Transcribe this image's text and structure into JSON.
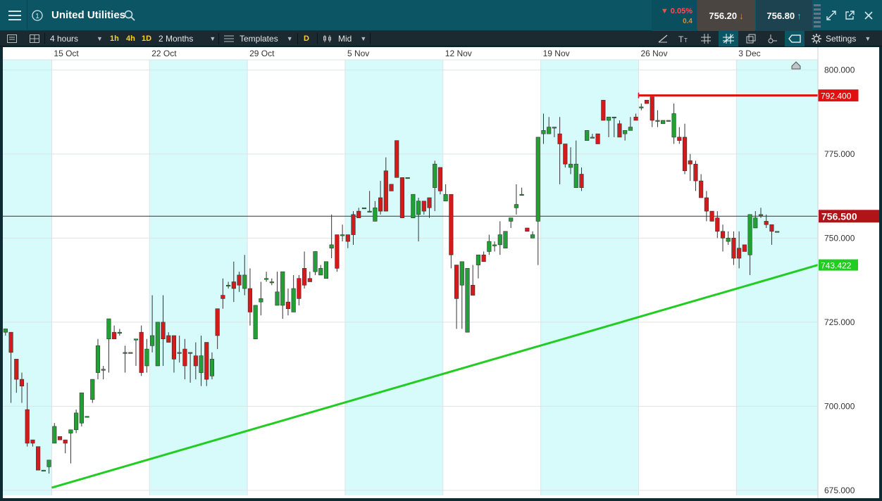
{
  "header": {
    "instrument": "United Utilities",
    "change_pct": "0.05%",
    "change_abs": "0.4",
    "sell_price": "756.20",
    "buy_price": "756.80",
    "colors": {
      "bar": "#0c5564",
      "sell": "#4a4540",
      "buy": "#1e4350",
      "down": "#ff4d4d"
    }
  },
  "toolbar": {
    "interval": "4 hours",
    "quick_1h": "1h",
    "quick_4h": "4h",
    "quick_1d": "1D",
    "range": "2 Months",
    "templates": "Templates",
    "d_badge": "D",
    "price_type": "Mid",
    "settings": "Settings"
  },
  "chart_data": {
    "type": "candlestick",
    "title": "",
    "xlabel": "",
    "ylabel": "",
    "ylim": [
      673.5,
      803
    ],
    "y_ticks": [
      {
        "value": 800,
        "label": "800.000"
      },
      {
        "value": 775,
        "label": "775.000"
      },
      {
        "value": 750,
        "label": "750.000"
      },
      {
        "value": 725,
        "label": "725.000"
      },
      {
        "value": 700,
        "label": "700.000"
      },
      {
        "value": 675,
        "label": "675.000"
      }
    ],
    "x_labels": [
      "15 Oct",
      "22 Oct",
      "29 Oct",
      "5 Nov",
      "12 Nov",
      "19 Nov",
      "26 Nov",
      "3 Dec"
    ],
    "x_label_slot": [
      9,
      27,
      45,
      63,
      81,
      99,
      117,
      135
    ],
    "shaded_weeks": [
      [
        0,
        9
      ],
      [
        27,
        45
      ],
      [
        63,
        81
      ],
      [
        99,
        117
      ],
      [
        135,
        150
      ]
    ],
    "total_slots": 150,
    "candles": [
      [
        722,
        723,
        721,
        722.5
      ],
      [
        722,
        716,
        701,
        709
      ],
      [
        714,
        708,
        704,
        701
      ],
      [
        708,
        706,
        701,
        710
      ],
      [
        699,
        689,
        688,
        707
      ],
      [
        690,
        689,
        688,
        689
      ],
      [
        688,
        681,
        681,
        679
      ],
      [
        681,
        681,
        681,
        681
      ],
      [
        682,
        684,
        680,
        682
      ],
      [
        689,
        694,
        689,
        695
      ],
      [
        691,
        690,
        690,
        688
      ],
      [
        690,
        689,
        686,
        689
      ],
      [
        692,
        693,
        683,
        692
      ],
      [
        693,
        698,
        692,
        699
      ],
      [
        695,
        704,
        694,
        700
      ],
      [
        697,
        697,
        697,
        697
      ],
      [
        702,
        708,
        701,
        707
      ],
      [
        710,
        718,
        708,
        720
      ],
      [
        711,
        711,
        708,
        712
      ],
      [
        720,
        726,
        710,
        722
      ],
      [
        722,
        720,
        720,
        724
      ],
      [
        722,
        722,
        721,
        723
      ],
      [
        716,
        716,
        710,
        718
      ],
      [
        716,
        716,
        716,
        716
      ],
      [
        720,
        720,
        712,
        720
      ],
      [
        722,
        710,
        709,
        724
      ],
      [
        712,
        717,
        710,
        720
      ],
      [
        718,
        721,
        716,
        733
      ],
      [
        712,
        725,
        712,
        725
      ],
      [
        725,
        720,
        712,
        733
      ],
      [
        721,
        719,
        720,
        722
      ],
      [
        721,
        714,
        710,
        718
      ],
      [
        716,
        716,
        713,
        721
      ],
      [
        717,
        712,
        708,
        720
      ],
      [
        716,
        716,
        707,
        716
      ],
      [
        715,
        712,
        708,
        719
      ],
      [
        710,
        715,
        706,
        721
      ],
      [
        719,
        708,
        706,
        719
      ],
      [
        709,
        714,
        708,
        716
      ],
      [
        729,
        721,
        717,
        727
      ],
      [
        733,
        732,
        729,
        738
      ],
      [
        736,
        736,
        735,
        737
      ],
      [
        737,
        735,
        731,
        743
      ],
      [
        739,
        736,
        734,
        740
      ],
      [
        735,
        739,
        733,
        745
      ],
      [
        735,
        728,
        724,
        741
      ],
      [
        720,
        730,
        727,
        729
      ],
      [
        731,
        732,
        727,
        737
      ],
      [
        738,
        738,
        737,
        740
      ],
      [
        737,
        737,
        736,
        738
      ],
      [
        730,
        734,
        734,
        740
      ],
      [
        730,
        740,
        726,
        738
      ],
      [
        731,
        729,
        727,
        735
      ],
      [
        728,
        735,
        728,
        739
      ],
      [
        738,
        732,
        730,
        739
      ],
      [
        741,
        736,
        735,
        746
      ],
      [
        738,
        737,
        737,
        740
      ],
      [
        740,
        746,
        739,
        746
      ],
      [
        739,
        741,
        739,
        742
      ],
      [
        738,
        743,
        738,
        743
      ],
      [
        747,
        748,
        744,
        757
      ],
      [
        751,
        741,
        740,
        751
      ],
      [
        751,
        751,
        749,
        754
      ],
      [
        751,
        749,
        747,
        751
      ],
      [
        757,
        751,
        748,
        758
      ],
      [
        758,
        756,
        756,
        759
      ],
      [
        759,
        759,
        759,
        759
      ],
      [
        758,
        758,
        758,
        764
      ],
      [
        755,
        759,
        755,
        761
      ],
      [
        762,
        758,
        757,
        767
      ],
      [
        770,
        758,
        758,
        774
      ],
      [
        766,
        764,
        764,
        766
      ],
      [
        779,
        768,
        768,
        768
      ],
      [
        768,
        756,
        756,
        766
      ],
      [
        768,
        768,
        768,
        768
      ],
      [
        756,
        763,
        762,
        763
      ],
      [
        757,
        761,
        749,
        762
      ],
      [
        761,
        758,
        757,
        759
      ],
      [
        762,
        759,
        756,
        762
      ],
      [
        765,
        772,
        758,
        773
      ],
      [
        771,
        764,
        763,
        771
      ],
      [
        761,
        763,
        763,
        766
      ],
      [
        763,
        745,
        741,
        763
      ],
      [
        742,
        732,
        723,
        739
      ],
      [
        736,
        743,
        723,
        738
      ],
      [
        722,
        741,
        723,
        741
      ],
      [
        736,
        733,
        733,
        742
      ],
      [
        742,
        745,
        738,
        742
      ],
      [
        745,
        743,
        743,
        746
      ],
      [
        746,
        749,
        745,
        751
      ],
      [
        748,
        748,
        746,
        749
      ],
      [
        748,
        751,
        745,
        755
      ],
      [
        747,
        752,
        747,
        752
      ],
      [
        755,
        756,
        753,
        755
      ],
      [
        759,
        760,
        757,
        766
      ],
      [
        763,
        763,
        764,
        765
      ],
      [
        753,
        752,
        752,
        753
      ],
      [
        750,
        751,
        752,
        752
      ],
      [
        755,
        780,
        742,
        780
      ],
      [
        781,
        782,
        778,
        787
      ],
      [
        781,
        783,
        783,
        786
      ],
      [
        783,
        783,
        780,
        783
      ],
      [
        781,
        778,
        766,
        786
      ],
      [
        778,
        772,
        771,
        778
      ],
      [
        771,
        772,
        769,
        777
      ],
      [
        765,
        772,
        767,
        779
      ],
      [
        769,
        765,
        764,
        771
      ],
      [
        779,
        782,
        780,
        778
      ],
      [
        780,
        780,
        780,
        781
      ],
      [
        781,
        778,
        778,
        779
      ],
      [
        791,
        785,
        785,
        788
      ],
      [
        785,
        786,
        780,
        785
      ],
      [
        786,
        786,
        780,
        786
      ],
      [
        784,
        780,
        780,
        785
      ],
      [
        781,
        782,
        779,
        782
      ],
      [
        782,
        783,
        785,
        786
      ],
      [
        786,
        785,
        785,
        787
      ],
      [
        789,
        789,
        788,
        790
      ],
      [
        791,
        790,
        790,
        791
      ],
      [
        792,
        785,
        783,
        791
      ],
      [
        785,
        785,
        783,
        788
      ],
      [
        784,
        785,
        785,
        785
      ],
      [
        785,
        785,
        785,
        785
      ],
      [
        780,
        787,
        778,
        790
      ],
      [
        780,
        779,
        778,
        783
      ],
      [
        780,
        770,
        769,
        784
      ],
      [
        773,
        772,
        767,
        775
      ],
      [
        772,
        767,
        764,
        773
      ],
      [
        767,
        762,
        762,
        769
      ],
      [
        762,
        758,
        755,
        764
      ],
      [
        758,
        755,
        755,
        757
      ],
      [
        756,
        752,
        750,
        758
      ],
      [
        752,
        750,
        746,
        754
      ],
      [
        749,
        750,
        748,
        752
      ],
      [
        750,
        744,
        742,
        752
      ],
      [
        747,
        744,
        741,
        752
      ],
      [
        748,
        746,
        746,
        748
      ],
      [
        745,
        757,
        739,
        757
      ],
      [
        753,
        756,
        756,
        758
      ],
      [
        757,
        757,
        756,
        759
      ],
      [
        755,
        754,
        753,
        757
      ],
      [
        754,
        752,
        748,
        753
      ],
      [
        752,
        752,
        752,
        752
      ]
    ],
    "horizontal_lines": [
      {
        "value": 792.4,
        "label": "792.400",
        "color": "#e01010",
        "from_slot": 117
      },
      {
        "value": 756.5,
        "label": "756.500",
        "color": "#c0171b",
        "from_slot": 0
      }
    ],
    "trendline": {
      "from": [
        9,
        675.8
      ],
      "to": [
        150,
        742
      ],
      "label": "743.422",
      "color": "#22cc22"
    },
    "colors": {
      "up": "#22a035",
      "down": "#d41a1a",
      "shade": "#d7fbfb",
      "grid": "#dde3e5"
    }
  }
}
